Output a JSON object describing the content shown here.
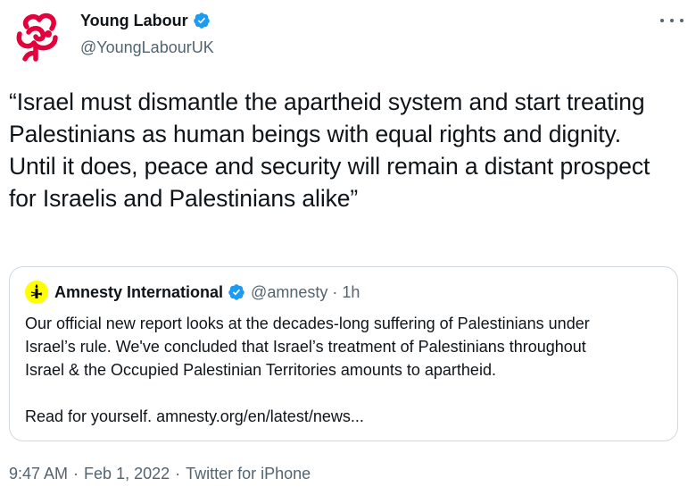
{
  "author": {
    "name": "Young Labour",
    "handle": "@YoungLabourUK",
    "avatar_icon": "red-rose-icon",
    "verified": true
  },
  "tweet": {
    "text": "“Israel must dismantle the apartheid system and start treating Palestinians as human beings with equal rights and dignity. Until it does, peace and security will remain a distant prospect for Israelis and Palestinians alike”"
  },
  "quote": {
    "name": "Amnesty International",
    "handle": "@amnesty",
    "separator": "·",
    "time": "1h",
    "verified": true,
    "avatar_icon": "amnesty-candle-icon",
    "lines": [
      "Our official new report looks at the decades-long suffering of Palestinians under",
      "Israel’s rule. We've concluded that Israel’s treatment of Palestinians throughout",
      "Israel & the Occupied Palestinian Territories amounts to apartheid."
    ],
    "link_line": "Read for yourself. amnesty.org/en/latest/news..."
  },
  "footer": {
    "time": "9:47 AM",
    "separator": "·",
    "date": "Feb 1, 2022",
    "source": "Twitter for iPhone"
  },
  "colors": {
    "verified_blue": "#1d9bf0",
    "labour_red": "#e4003b",
    "amnesty_yellow": "#ffff00",
    "secondary_text": "#536471"
  }
}
